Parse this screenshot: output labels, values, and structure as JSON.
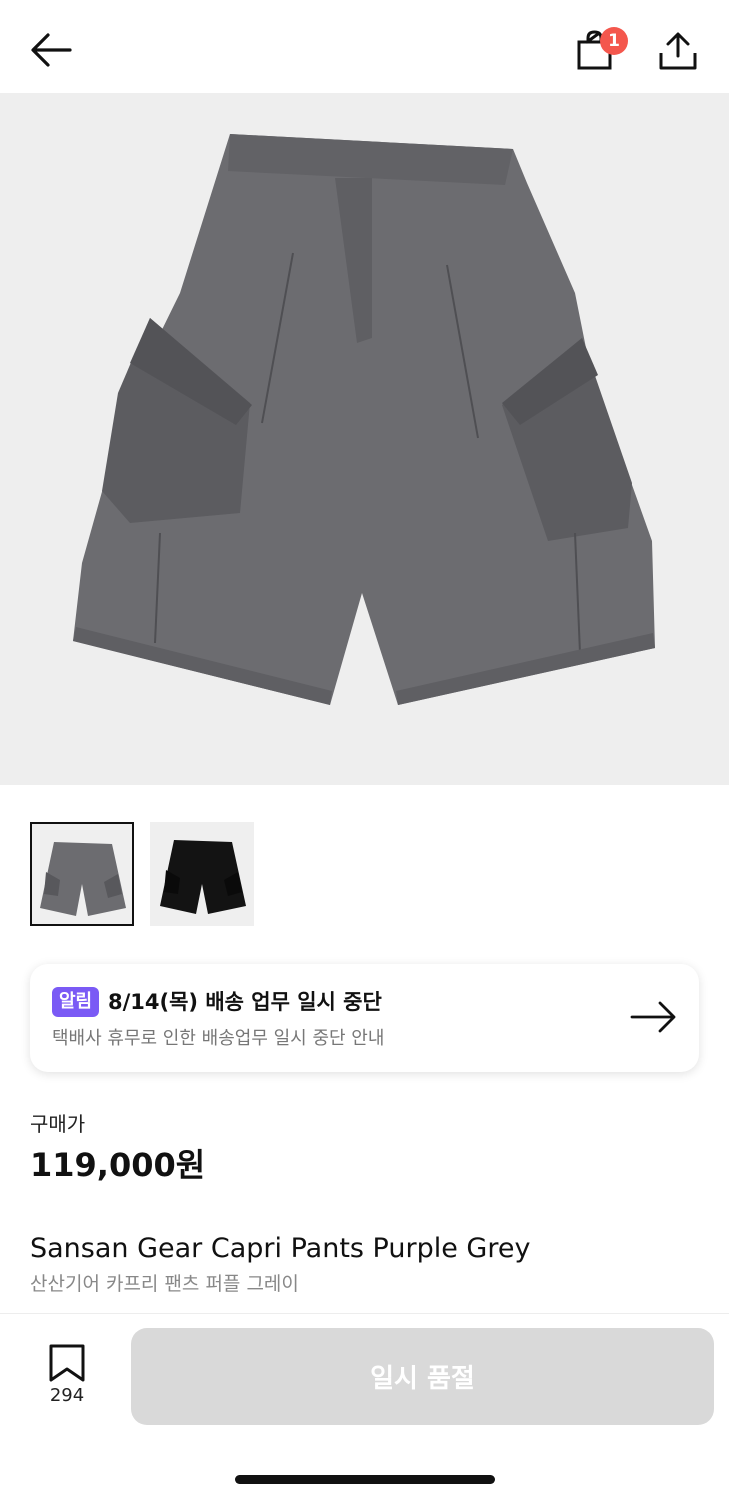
{
  "header": {
    "back_icon": "arrow-left-icon",
    "cart_icon": "shopping-bag-icon",
    "cart_badge": "1",
    "share_icon": "share-icon",
    "badge_color": "#f4574d"
  },
  "product_image": {
    "icon": "product-photo-grey-cargo-shorts"
  },
  "thumbnails": [
    {
      "icon": "thumbnail-grey-shorts",
      "selected": true
    },
    {
      "icon": "thumbnail-black-shorts",
      "selected": false
    }
  ],
  "notice": {
    "tag": "알림",
    "title": "8/14(목) 배송 업무 일시 중단",
    "subtitle": "택배사 휴무로 인한 배송업무 일시 중단 안내",
    "tag_color": "#7a5af5",
    "arrow_icon": "arrow-right-icon"
  },
  "price": {
    "label": "구매가",
    "value": "119,000원"
  },
  "product": {
    "name_en": "Sansan Gear Capri Pants Purple Grey",
    "name_ko": "산산기어 카프리 팬츠 퍼플 그레이"
  },
  "bottom_bar": {
    "bookmark_icon": "bookmark-icon",
    "bookmark_count": "294",
    "button_label": "일시 품절",
    "button_color": "#d9d9d9"
  }
}
